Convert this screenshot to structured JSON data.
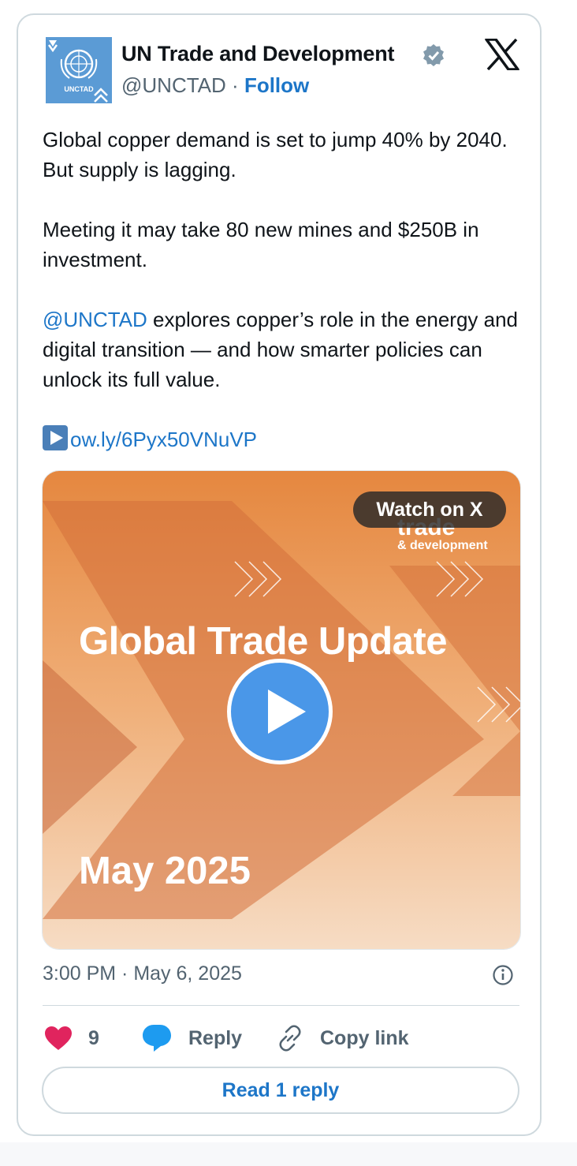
{
  "author": {
    "name": "UN Trade and Development",
    "handle": "@UNCTAD",
    "separator": "·",
    "follow_label": "Follow",
    "avatar_text": "UNCTAD"
  },
  "tweet": {
    "line1": "Global copper demand is set to jump 40% by 2040. But supply is lagging.",
    "line2": "Meeting it may take 80 new mines and $250B in investment.",
    "mention": "@UNCTAD",
    "line3_rest": " explores copper’s role in the energy and digital transition — and how smarter policies can unlock its full value.",
    "link": "ow.ly/6Pyx50VNuVP"
  },
  "media": {
    "watch_label": "Watch on X",
    "brand_top": "trade",
    "brand_sub": "& development",
    "title": "Global Trade Update",
    "date": "May 2025"
  },
  "meta": {
    "timestamp": "3:00 PM · May 6, 2025"
  },
  "actions": {
    "like_count": "9",
    "reply_label": "Reply",
    "copy_label": "Copy link",
    "read_reply_label": "Read 1 reply"
  },
  "colors": {
    "accent": "#1d76c8",
    "like": "#e0245e",
    "reply": "#1d9bf0"
  }
}
